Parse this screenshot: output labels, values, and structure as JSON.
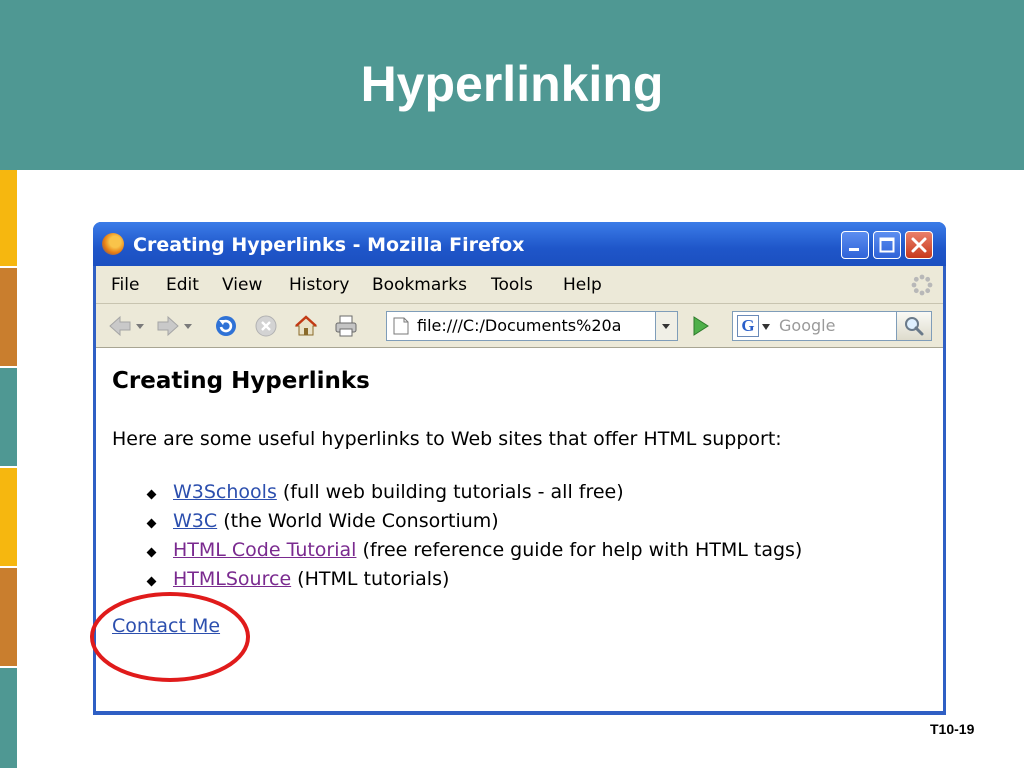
{
  "slide": {
    "title": "Hyperlinking",
    "slide_number": "T10-19",
    "header_color": "#4f9893",
    "strip_colors": [
      "#f6b70f",
      "#c97e2e",
      "#4f9893",
      "#f6b70f",
      "#c97e2e",
      "#4f9893"
    ]
  },
  "browser": {
    "window_title": "Creating Hyperlinks - Mozilla Firefox",
    "title_icon": "firefox-logo-icon",
    "window_controls": [
      "minimize-icon",
      "maximize-icon",
      "close-icon"
    ],
    "menu": [
      "File",
      "Edit",
      "View",
      "History",
      "Bookmarks",
      "Tools",
      "Help"
    ],
    "toolbar_icons": [
      "back-icon",
      "back-dropdown-icon",
      "forward-icon",
      "forward-dropdown-icon",
      "reload-icon",
      "stop-icon",
      "home-icon",
      "print-icon"
    ],
    "address": "file:///C:/Documents%20a",
    "search_placeholder": "Google",
    "link_color": "#2c4fae",
    "visited_color": "#7a2a8f"
  },
  "page": {
    "heading": "Creating Hyperlinks",
    "intro": "Here are some useful hyperlinks to Web sites that offer HTML support:",
    "links": [
      {
        "text": "W3Schools",
        "desc": " (full web building tutorials - all free)"
      },
      {
        "text": "W3C",
        "desc": " (the World Wide Consortium)"
      },
      {
        "text": "HTML Code Tutorial",
        "desc": " (free reference guide for help with HTML tags)"
      },
      {
        "text": "HTMLSource",
        "desc": " (HTML tutorials)"
      }
    ],
    "contact": "Contact Me"
  },
  "annotation": {
    "ring_color": "#e01b1b"
  }
}
